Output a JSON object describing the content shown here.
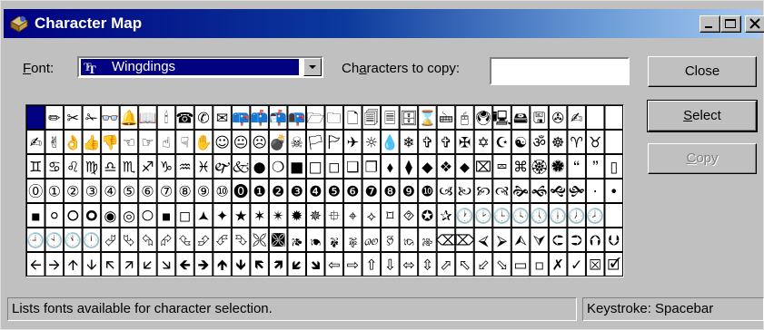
{
  "window": {
    "title": "Character Map",
    "app_icon": "character-map-icon"
  },
  "titlebar_buttons": [
    "minimize-icon",
    "maximize-icon",
    "close-icon"
  ],
  "font": {
    "label_prefix": "",
    "label_accel": "F",
    "label_rest": "ont:",
    "value": "Wingdings",
    "icon": "truetype-icon"
  },
  "copy": {
    "label_before": "Ch",
    "label_accel": "a",
    "label_after": "racters to copy:",
    "value": ""
  },
  "buttons": {
    "close": "Close",
    "select_accel": "S",
    "select_rest": "elect",
    "copy_accel": "C",
    "copy_rest": "opy"
  },
  "grid": {
    "rows": [
      [
        "",
        "✏",
        "✂",
        "✁",
        "👓",
        "🔔",
        "📖",
        "🕯",
        "☎",
        "✆",
        "✉",
        "📪",
        "📫",
        "📬",
        "📭",
        "🗁",
        "🗀",
        "🗋",
        "🗐",
        "🗏",
        "🗄",
        "⌛",
        "🖮",
        "🖰",
        "🖲",
        "🖳",
        "🖴",
        "🖫",
        "✇",
        "✍"
      ],
      [
        "✍",
        "✌",
        "👌",
        "👍",
        "👎",
        "☜",
        "☞",
        "☝",
        "☟",
        "✋",
        "☺",
        "😐",
        "☹",
        "💣",
        "☠",
        "🏳",
        "🏱",
        "✈",
        "☼",
        "💧",
        "❄",
        "✞",
        "✞",
        "✠",
        "✡",
        "☪",
        "☯",
        "ॐ",
        "☸",
        "♈",
        "♉"
      ],
      [
        "♊",
        "♋",
        "♌",
        "♍",
        "♎",
        "♏",
        "♐",
        "♑",
        "♒",
        "♓",
        "🙰",
        "🙵",
        "●",
        "❍",
        "■",
        "□",
        "◻",
        "❑",
        "❒",
        "⬧",
        "⧫",
        "◆",
        "❖",
        "⬥",
        "⌧",
        "⮹",
        "⌘",
        "🏵",
        "🏶",
        "🙶",
        "🙷",
        "▯"
      ],
      [
        "⓪",
        "①",
        "②",
        "③",
        "④",
        "⑤",
        "⑥",
        "⑦",
        "⑧",
        "⑨",
        "⑩",
        "⓿",
        "❶",
        "❷",
        "❸",
        "❹",
        "❺",
        "❻",
        "❼",
        "❽",
        "❾",
        "❿",
        "🙢",
        "🙠",
        "🙡",
        "🙣",
        "🙞",
        "🙜",
        "🙝",
        "🙟",
        "·",
        "•"
      ],
      [
        "▪",
        "⚪",
        "🞆",
        "🞈",
        "◉",
        "◎",
        "🞅",
        "▪",
        "◻",
        "🟂",
        "✦",
        "★",
        "✶",
        "✴",
        "✹",
        "✵",
        "⯐",
        "⌖",
        "⟡",
        "⌑",
        "⯑",
        "✪",
        "✰",
        "🕐",
        "🕑",
        "🕒",
        "🕓",
        "🕔",
        "🕕",
        "🕖",
        "🕗"
      ],
      [
        "🕘",
        "🕙",
        "🕚",
        "🕛",
        "⮰",
        "⮱",
        "⮲",
        "⮳",
        "⮴",
        "⮵",
        "⮶",
        "⮷",
        "🙪",
        "🙫",
        "🙕",
        "🙔",
        "🙗",
        "🙖",
        "🙐",
        "🙑",
        "🙒",
        "🙓",
        "⌫",
        "⌦",
        "⮘",
        "⮚",
        "⮙",
        "⮛",
        "⮈",
        "⮊",
        "⮉",
        "⮋"
      ],
      [
        "🡨",
        "🡪",
        "🡩",
        "🡫",
        "🡬",
        "🡭",
        "🡯",
        "🡮",
        "🡸",
        "🡺",
        "🡹",
        "🡻",
        "🡼",
        "🡽",
        "🡿",
        "🡾",
        "⇦",
        "⇨",
        "⇧",
        "⇩",
        "⬄",
        "⇳",
        "⬀",
        "⬁",
        "⬃",
        "⬂",
        "▭",
        "▫",
        "✗",
        "✓",
        "⮽",
        "🗹"
      ]
    ]
  },
  "status": {
    "left": "Lists fonts available for character selection.",
    "right": "Keystroke: Spacebar"
  }
}
